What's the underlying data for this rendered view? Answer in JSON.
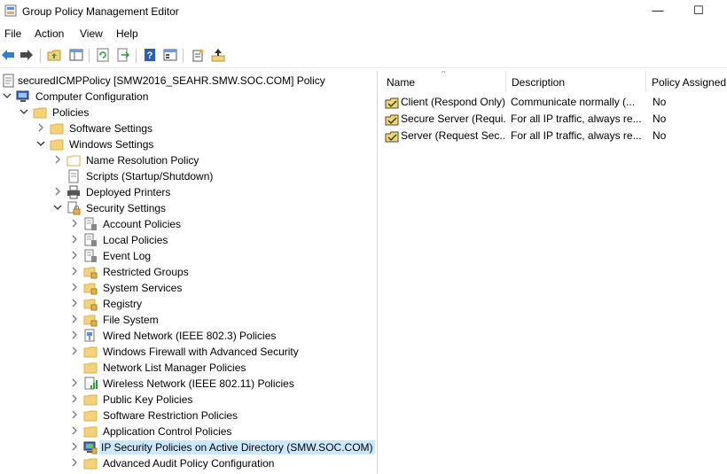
{
  "window": {
    "title": "Group Policy Management Editor",
    "minimize_glyph": "—",
    "maximize_glyph": "☐"
  },
  "menu": [
    "File",
    "Action",
    "View",
    "Help"
  ],
  "toolbar": [
    "back-icon",
    "forward-icon",
    "up-folder-icon",
    "show-hide-tree-icon",
    "refresh-icon",
    "export-list-icon",
    "help-icon",
    "properties-icon",
    "new-policy-icon",
    "manage-filter-icon"
  ],
  "tree": {
    "root": "securedICMPPolicy [SMW2016_SEAHR.SMW.SOC.COM] Policy",
    "computer_configuration": "Computer Configuration",
    "policies": "Policies",
    "software_settings": "Software Settings",
    "windows_settings": "Windows Settings",
    "name_resolution_policy": "Name Resolution Policy",
    "scripts": "Scripts (Startup/Shutdown)",
    "deployed_printers": "Deployed Printers",
    "security_settings": "Security Settings",
    "account_policies": "Account Policies",
    "local_policies": "Local Policies",
    "event_log": "Event Log",
    "restricted_groups": "Restricted Groups",
    "system_services": "System Services",
    "registry": "Registry",
    "file_system": "File System",
    "wired_network": "Wired Network (IEEE 802.3) Policies",
    "windows_firewall": "Windows Firewall with Advanced Security",
    "network_list_manager": "Network List Manager Policies",
    "wireless_network": "Wireless Network (IEEE 802.11) Policies",
    "public_key": "Public Key Policies",
    "software_restriction": "Software Restriction Policies",
    "application_control": "Application Control Policies",
    "ip_security": "IP Security Policies on Active Directory (SMW.SOC.COM)",
    "advanced_audit": "Advanced Audit Policy Configuration"
  },
  "list": {
    "columns": [
      "Name",
      "Description",
      "Policy Assigned"
    ],
    "rows": [
      {
        "name": "Client (Respond Only)",
        "description": "Communicate normally (...",
        "assigned": "No"
      },
      {
        "name": "Secure Server (Requi...",
        "description": "For all IP traffic, always re...",
        "assigned": "No"
      },
      {
        "name": "Server (Request Sec...",
        "description": "For all IP traffic, always re...",
        "assigned": "No"
      }
    ]
  },
  "colors": {
    "selection": "#cce8ff",
    "folder": "#f4d27a",
    "folder_dark": "#dcb04f"
  }
}
